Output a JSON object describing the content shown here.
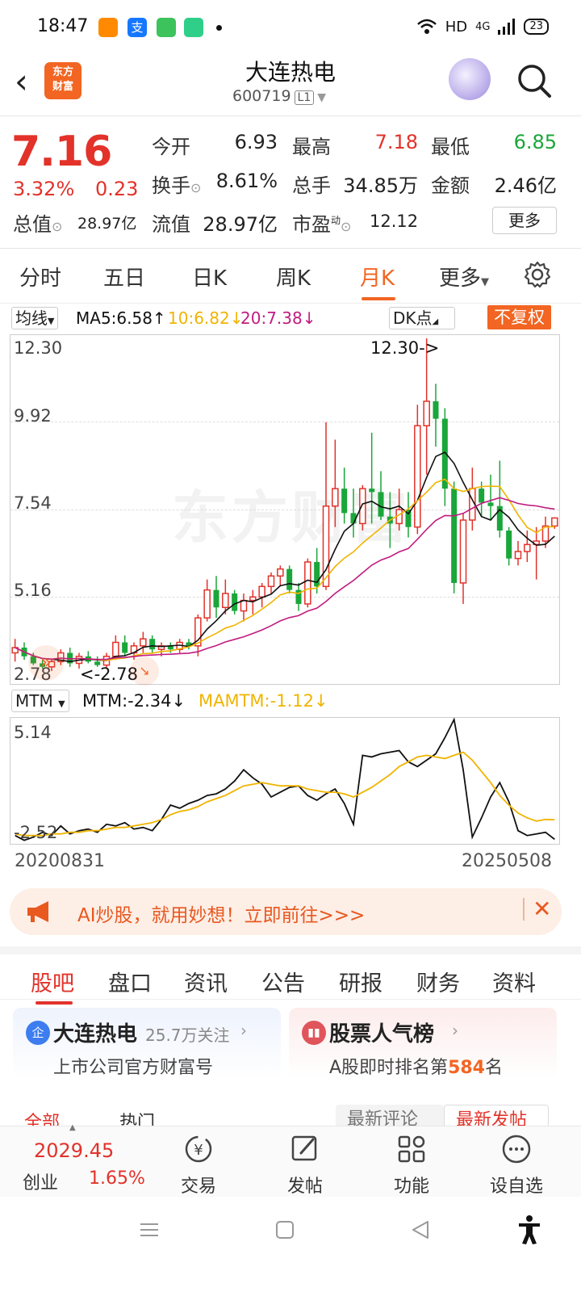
{
  "status_bar": {
    "time": "18:47",
    "network": "HD",
    "signal": "4G",
    "battery": "23"
  },
  "header": {
    "title": "大连热电",
    "code": "600719",
    "level": "L1",
    "logo_text": [
      "东方",
      "财富"
    ]
  },
  "quote": {
    "price": "7.16",
    "change_pct": "3.32%",
    "change": "0.23",
    "fields": {
      "open_label": "今开",
      "open": "6.93",
      "high_label": "最高",
      "high": "7.18",
      "low_label": "最低",
      "low": "6.85",
      "turnover_label": "换手",
      "turnover": "8.61%",
      "volume_label": "总手",
      "volume": "34.85万",
      "amount_label": "金额",
      "amount": "2.46亿",
      "mktcap_label": "总值",
      "mktcap": "28.97亿",
      "float_label": "流值",
      "float": "28.97亿",
      "pe_label": "市盈",
      "pe_sup": "动",
      "pe": "12.12"
    },
    "more_button": "更多"
  },
  "chart_tabs": [
    "分时",
    "五日",
    "日K",
    "周K",
    "月K",
    "更多"
  ],
  "active_chart_tab": "月K",
  "kline": {
    "ma_select": "均线",
    "ma5": "MA5:6.58↑",
    "ma10": "10:6.82↓",
    "ma20": "20:7.38↓",
    "dk_button": "DK点",
    "adjust_button": "不复权",
    "y_labels": [
      "12.30",
      "9.92",
      "7.54",
      "5.16",
      "2.78"
    ],
    "high_marker": "12.30->",
    "low_marker": "<-2.78",
    "watermark": "东方财富"
  },
  "mtm": {
    "select": "MTM",
    "mtm": "MTM:-2.34↓",
    "mamtm": "MAMTM:-1.12↓",
    "y_top": "5.14",
    "y_bottom": "-2.52",
    "date_start": "20200831",
    "date_end": "20250508"
  },
  "ad_banner": {
    "text": "AI炒股，就用妙想！立即前往>>>"
  },
  "page_tabs": [
    "股吧",
    "盘口",
    "资讯",
    "公告",
    "研报",
    "财务",
    "资料"
  ],
  "active_page_tab": "股吧",
  "cards": [
    {
      "title": "大连热电",
      "followers": "25.7万关注",
      "subtitle": "上市公司官方财富号",
      "icon": "企"
    },
    {
      "title": "股票人气榜",
      "subtitle_pre": "A股即时排名第",
      "rank": "584",
      "subtitle_post": "名"
    }
  ],
  "filter_peek": {
    "all": "全部",
    "hot": "热门",
    "latest_comment": "最新评论",
    "latest_post": "最新发帖"
  },
  "bottom_bar": {
    "index_value": "2029.45",
    "index_name": "创业",
    "index_change": "1.65%",
    "items": [
      "交易",
      "发帖",
      "功能",
      "设自选"
    ]
  },
  "colors": {
    "up": "#e2322a",
    "down": "#1aa63a",
    "accent": "#f26522",
    "ma5": "#111111",
    "ma10": "#f0b400",
    "ma20": "#c01c80"
  },
  "chart_data": {
    "type": "candlestick",
    "ylim": [
      2.78,
      12.3
    ],
    "ohlc": [
      [
        3.3,
        3.7,
        3.05,
        3.45
      ],
      [
        3.45,
        3.6,
        3.1,
        3.2
      ],
      [
        3.2,
        3.3,
        2.95,
        3.0
      ],
      [
        3.0,
        3.1,
        2.85,
        2.9
      ],
      [
        2.9,
        3.1,
        2.78,
        3.05
      ],
      [
        3.05,
        3.4,
        2.95,
        3.3
      ],
      [
        3.3,
        3.45,
        2.9,
        3.0
      ],
      [
        3.0,
        3.3,
        2.85,
        3.2
      ],
      [
        3.2,
        3.35,
        3.0,
        3.05
      ],
      [
        3.05,
        3.2,
        2.9,
        2.95
      ],
      [
        2.95,
        3.3,
        2.85,
        3.2
      ],
      [
        3.2,
        3.8,
        3.1,
        3.6
      ],
      [
        3.6,
        3.8,
        3.2,
        3.3
      ],
      [
        3.3,
        3.6,
        3.1,
        3.5
      ],
      [
        3.5,
        3.9,
        3.3,
        3.7
      ],
      [
        3.7,
        3.8,
        3.3,
        3.4
      ],
      [
        3.4,
        3.6,
        3.2,
        3.5
      ],
      [
        3.5,
        3.6,
        3.3,
        3.4
      ],
      [
        3.4,
        3.7,
        3.3,
        3.6
      ],
      [
        3.6,
        3.7,
        3.4,
        3.5
      ],
      [
        3.5,
        4.4,
        3.2,
        4.3
      ],
      [
        4.3,
        5.4,
        4.2,
        5.1
      ],
      [
        5.1,
        5.5,
        4.3,
        4.6
      ],
      [
        4.6,
        5.4,
        4.4,
        5.0
      ],
      [
        5.0,
        5.1,
        4.4,
        4.5
      ],
      [
        4.5,
        5.0,
        4.2,
        4.8
      ],
      [
        4.8,
        5.1,
        4.4,
        4.9
      ],
      [
        4.9,
        5.3,
        4.6,
        5.2
      ],
      [
        5.2,
        5.6,
        5.0,
        5.5
      ],
      [
        5.5,
        5.8,
        5.2,
        5.7
      ],
      [
        5.7,
        5.8,
        5.0,
        5.1
      ],
      [
        5.1,
        5.3,
        4.5,
        4.7
      ],
      [
        4.7,
        6.0,
        4.6,
        5.9
      ],
      [
        5.9,
        6.3,
        5.0,
        5.2
      ],
      [
        5.2,
        9.9,
        5.1,
        7.5
      ],
      [
        7.5,
        9.4,
        6.9,
        8.0
      ],
      [
        8.0,
        8.6,
        7.0,
        7.3
      ],
      [
        7.3,
        8.0,
        6.6,
        7.0
      ],
      [
        7.0,
        8.1,
        6.8,
        8.0
      ],
      [
        8.0,
        9.6,
        7.0,
        7.9
      ],
      [
        7.9,
        8.5,
        7.1,
        7.2
      ],
      [
        7.2,
        7.9,
        6.3,
        7.0
      ],
      [
        7.0,
        8.0,
        6.8,
        7.4
      ],
      [
        7.4,
        7.9,
        6.6,
        6.9
      ],
      [
        6.9,
        10.4,
        6.7,
        9.8
      ],
      [
        9.8,
        12.3,
        8.4,
        10.5
      ],
      [
        10.5,
        11.0,
        9.2,
        10.0
      ],
      [
        10.0,
        10.3,
        7.5,
        8.0
      ],
      [
        8.0,
        8.2,
        5.0,
        5.3
      ],
      [
        5.3,
        7.3,
        4.7,
        7.1
      ],
      [
        7.1,
        8.6,
        6.8,
        8.0
      ],
      [
        8.0,
        8.2,
        7.2,
        7.6
      ],
      [
        7.6,
        8.4,
        7.1,
        7.5
      ],
      [
        7.5,
        8.8,
        6.6,
        6.8
      ],
      [
        6.8,
        6.9,
        5.8,
        6.0
      ],
      [
        6.0,
        6.5,
        5.8,
        6.2
      ],
      [
        6.2,
        6.8,
        5.9,
        6.4
      ],
      [
        6.4,
        6.9,
        5.4,
        6.5
      ],
      [
        6.5,
        7.2,
        6.3,
        6.93
      ],
      [
        6.93,
        7.18,
        6.85,
        7.16
      ]
    ],
    "ma_series": [
      {
        "name": "MA5"
      },
      {
        "name": "10"
      },
      {
        "name": "20"
      }
    ],
    "mtm": {
      "ylim": [
        -2.52,
        5.14
      ],
      "mtm": [
        -2.1,
        -2.4,
        -2.2,
        -1.9,
        -2.1,
        -1.5,
        -2.0,
        -1.8,
        -1.7,
        -1.9,
        -1.4,
        -1.5,
        -1.3,
        -1.7,
        -1.6,
        -1.8,
        -1.1,
        -0.2,
        -0.4,
        -0.1,
        0.1,
        0.4,
        0.5,
        0.8,
        1.3,
        2.0,
        1.5,
        1.1,
        0.3,
        0.6,
        0.9,
        1.0,
        0.4,
        0.1,
        0.5,
        0.8,
        -0.1,
        -1.4,
        2.9,
        2.8,
        3.0,
        3.1,
        3.2,
        2.5,
        2.2,
        2.6,
        3.0,
        4.0,
        5.14,
        2.0,
        -2.2,
        -1.0,
        0.3,
        1.2,
        0.0,
        -1.8,
        -2.1,
        -2.0,
        -1.9,
        -2.34
      ],
      "mamtm": [
        -2.0,
        -2.1,
        -2.1,
        -2.1,
        -2.0,
        -2.0,
        -1.9,
        -1.9,
        -1.8,
        -1.8,
        -1.7,
        -1.6,
        -1.6,
        -1.5,
        -1.4,
        -1.3,
        -1.1,
        -0.8,
        -0.6,
        -0.5,
        -0.3,
        0.0,
        0.2,
        0.4,
        0.7,
        1.0,
        1.1,
        1.2,
        1.1,
        1.0,
        1.0,
        1.0,
        0.8,
        0.7,
        0.6,
        0.6,
        0.5,
        0.3,
        0.6,
        0.9,
        1.3,
        1.7,
        2.2,
        2.5,
        2.8,
        2.9,
        2.8,
        2.7,
        2.9,
        3.1,
        2.6,
        1.9,
        1.2,
        0.4,
        -0.2,
        -0.7,
        -1.0,
        -1.2,
        -1.1,
        -1.12
      ]
    }
  }
}
